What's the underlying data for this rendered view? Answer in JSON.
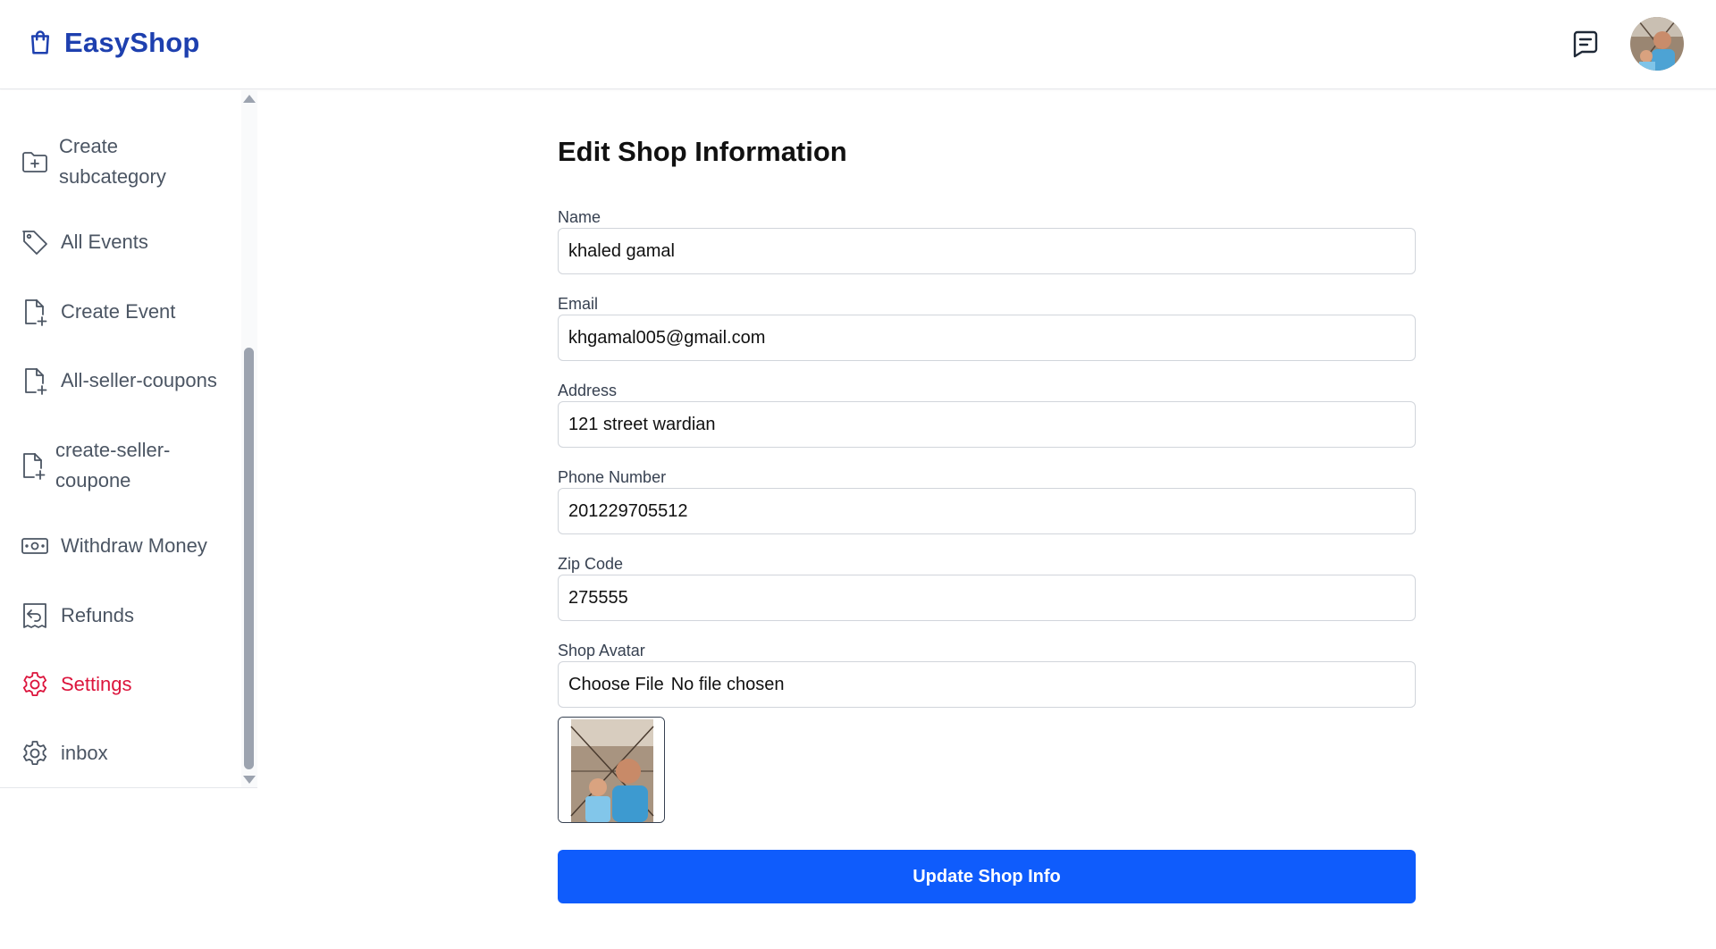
{
  "header": {
    "brand": "EasyShop",
    "brand_icon": "shopping-bag-icon",
    "message_icon": "message-icon",
    "avatar_alt": "user-avatar"
  },
  "sidebar": {
    "items": [
      {
        "label": "Create subcategory",
        "icon": "folder-plus-icon",
        "active": false
      },
      {
        "label": "All Events",
        "icon": "tag-icon",
        "active": false
      },
      {
        "label": "Create Event",
        "icon": "file-plus-icon",
        "active": false
      },
      {
        "label": "All-seller-coupons",
        "icon": "file-plus-icon",
        "active": false
      },
      {
        "label": "create-seller-coupone",
        "icon": "file-plus-icon",
        "active": false
      },
      {
        "label": "Withdraw Money",
        "icon": "money-icon",
        "active": false
      },
      {
        "label": "Refunds",
        "icon": "receipt-refund-icon",
        "active": false
      },
      {
        "label": "Settings",
        "icon": "gear-icon",
        "active": true
      },
      {
        "label": "inbox",
        "icon": "gear-icon",
        "active": false
      }
    ]
  },
  "form": {
    "title": "Edit Shop Information",
    "name": {
      "label": "Name",
      "value": "khaled gamal"
    },
    "email": {
      "label": "Email",
      "value": "khgamal005@gmail.com"
    },
    "address": {
      "label": "Address",
      "value": "121 street wardian"
    },
    "phone": {
      "label": "Phone Number",
      "value": "201229705512"
    },
    "zip": {
      "label": "Zip Code",
      "value": "275555"
    },
    "avatar": {
      "label": "Shop Avatar",
      "choose_label": "Choose File",
      "status": "No file chosen"
    },
    "submit_label": "Update Shop Info"
  },
  "colors": {
    "brand": "#1e40af",
    "active_nav": "#dc143c",
    "primary_button": "#0f5cfc"
  }
}
